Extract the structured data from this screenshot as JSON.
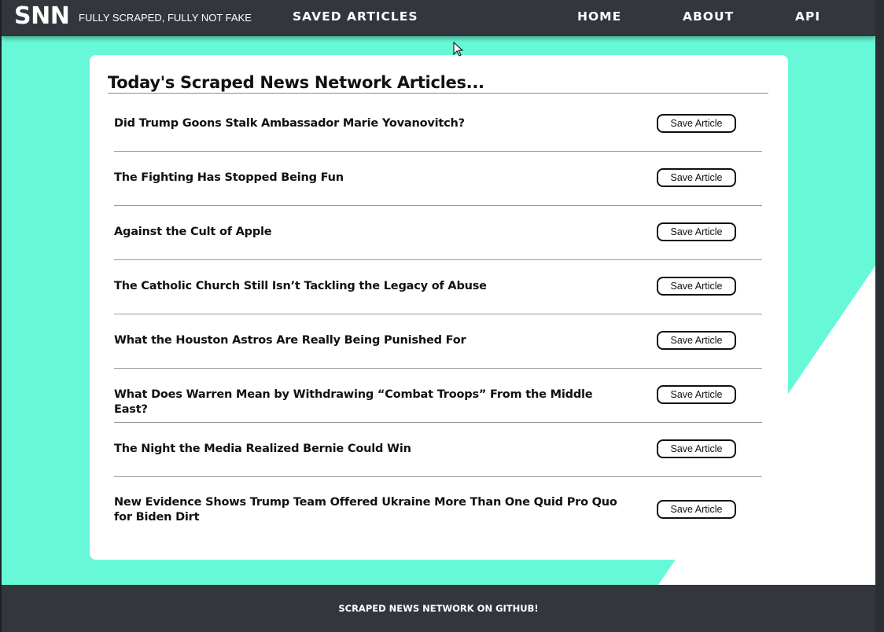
{
  "navbar": {
    "brand": "SNN",
    "tagline": "FULLY SCRAPED, FULLY NOT FAKE",
    "saved_articles": "SAVED ARTICLES",
    "home": "HOME",
    "about": "ABOUT",
    "api": "API"
  },
  "main": {
    "title": "Today's Scraped News Network Articles...",
    "articles": [
      {
        "title": "Did Trump Goons Stalk Ambassador Marie Yovanovitch?",
        "button": "Save Article"
      },
      {
        "title": "The Fighting Has Stopped Being Fun",
        "button": "Save Article"
      },
      {
        "title": "Against the Cult of Apple",
        "button": "Save Article"
      },
      {
        "title": "The Catholic Church Still Isn’t Tackling the Legacy of Abuse",
        "button": "Save Article"
      },
      {
        "title": "What the Houston Astros Are Really Being Punished For",
        "button": "Save Article"
      },
      {
        "title": "What Does Warren Mean by Withdrawing “Combat Troops” From the Middle East?",
        "button": "Save Article"
      },
      {
        "title": "The Night the Media Realized Bernie Could Win",
        "button": "Save Article"
      },
      {
        "title": "New Evidence Shows Trump Team Offered Ukraine More Than One Quid Pro Quo for Biden Dirt",
        "button": "Save Article"
      }
    ]
  },
  "footer": {
    "link": "SCRAPED NEWS NETWORK ON GITHUB!"
  },
  "colors": {
    "accent": "#67f9d7",
    "nav_bg": "#33363d",
    "card_bg": "#ffffff",
    "text": "#111111"
  }
}
